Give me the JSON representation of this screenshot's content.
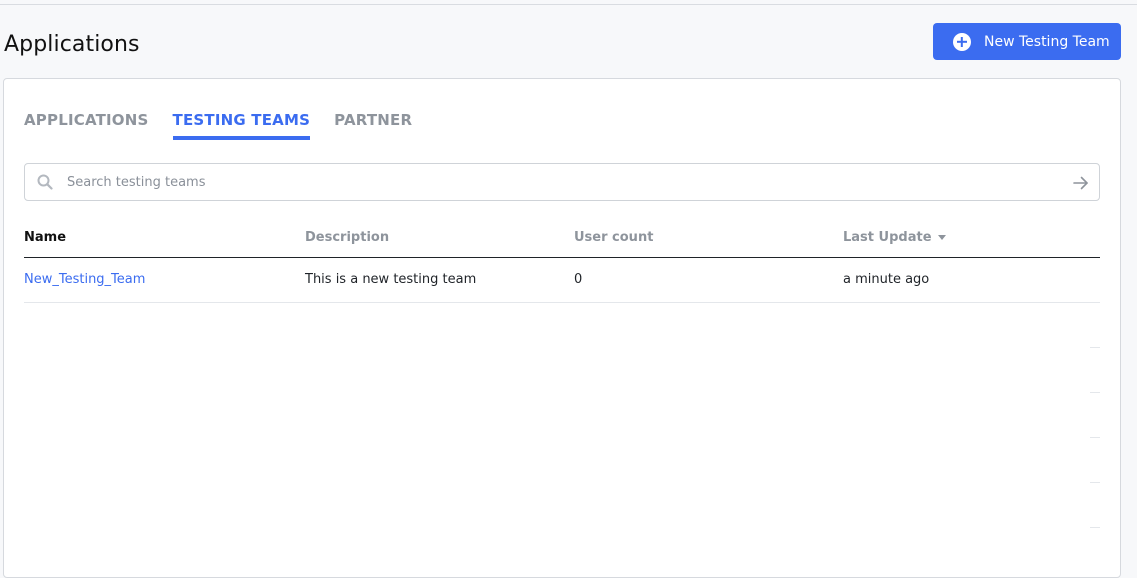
{
  "page": {
    "title": "Applications"
  },
  "header": {
    "new_button_label": "New Testing Team"
  },
  "tabs": [
    {
      "label": "APPLICATIONS",
      "active": false
    },
    {
      "label": "TESTING TEAMS",
      "active": true
    },
    {
      "label": "PARTNER",
      "active": false
    }
  ],
  "search": {
    "placeholder": "Search testing teams",
    "value": ""
  },
  "table": {
    "columns": [
      "Name",
      "Description",
      "User count",
      "Last Update"
    ],
    "sorted_column": "Last Update",
    "rows": [
      {
        "name": "New_Testing_Team",
        "description": "This is a new testing team",
        "user_count": "0",
        "last_update": "a minute ago"
      }
    ]
  },
  "colors": {
    "accent": "#3b6cf0",
    "muted": "#8e949c"
  },
  "icons": {
    "add": "plus-circle-icon",
    "search": "search-icon",
    "submit": "arrow-right-icon",
    "sort": "caret-down-icon"
  }
}
